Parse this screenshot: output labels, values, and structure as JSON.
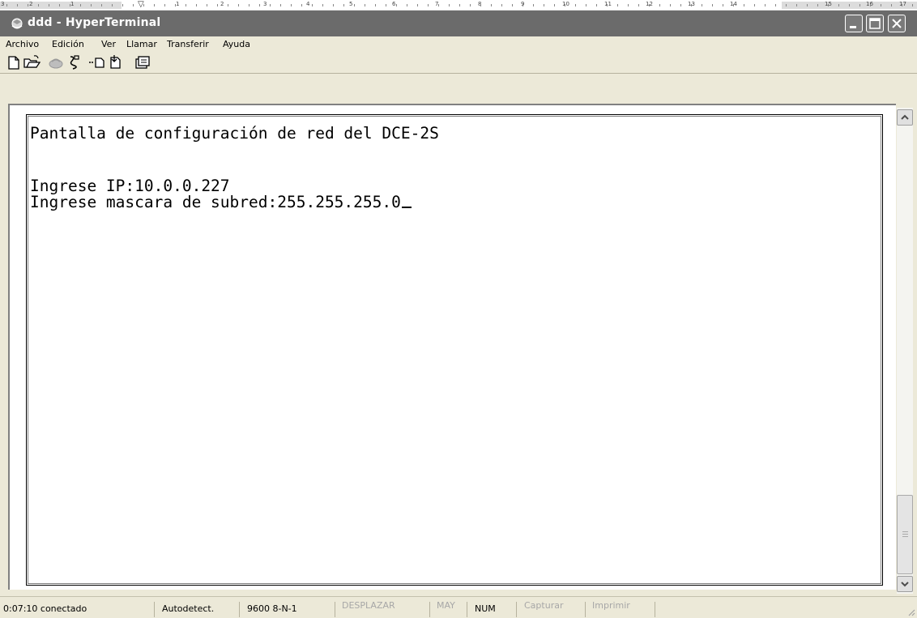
{
  "ruler": {
    "numbers": [
      "3",
      "2",
      "1",
      "1",
      "2",
      "3",
      "4",
      "5",
      "6",
      "7",
      "8",
      "9",
      "10",
      "11",
      "12",
      "13",
      "14",
      "15",
      "16",
      "17"
    ]
  },
  "window": {
    "title": "ddd - HyperTerminal",
    "title_icon": "hyperterminal-icon",
    "controls": [
      "minimize-icon",
      "maximize-icon",
      "close-icon"
    ]
  },
  "menubar": {
    "items": [
      "Archivo",
      "Edición",
      "Ver",
      "Llamar",
      "Transferir",
      "Ayuda"
    ]
  },
  "toolbar": {
    "icons": [
      "new-file-icon",
      "open-folder-icon",
      "call-icon",
      "disconnect-icon",
      "send-icon",
      "receive-icon",
      "properties-icon"
    ]
  },
  "terminal": {
    "lines": [
      "Pantalla de configuración de red del DCE-2S",
      "",
      "",
      "Ingrese IP:10.0.0.227",
      "Ingrese mascara de subred:255.255.255.0"
    ],
    "cursor": "_"
  },
  "statusbar": {
    "connection_time": "0:07:10 conectado",
    "detect": "Autodetect.",
    "port_settings": "9600 8-N-1",
    "scroll": "DESPLAZAR",
    "caps": "MAY",
    "num": "NUM",
    "capture": "Capturar",
    "print": "Imprimir"
  },
  "colors": {
    "titlebar": "#6b6b6b",
    "chrome": "#ece9d8",
    "terminal_bg": "#ffffff",
    "dim_text": "#a7a7a7"
  }
}
